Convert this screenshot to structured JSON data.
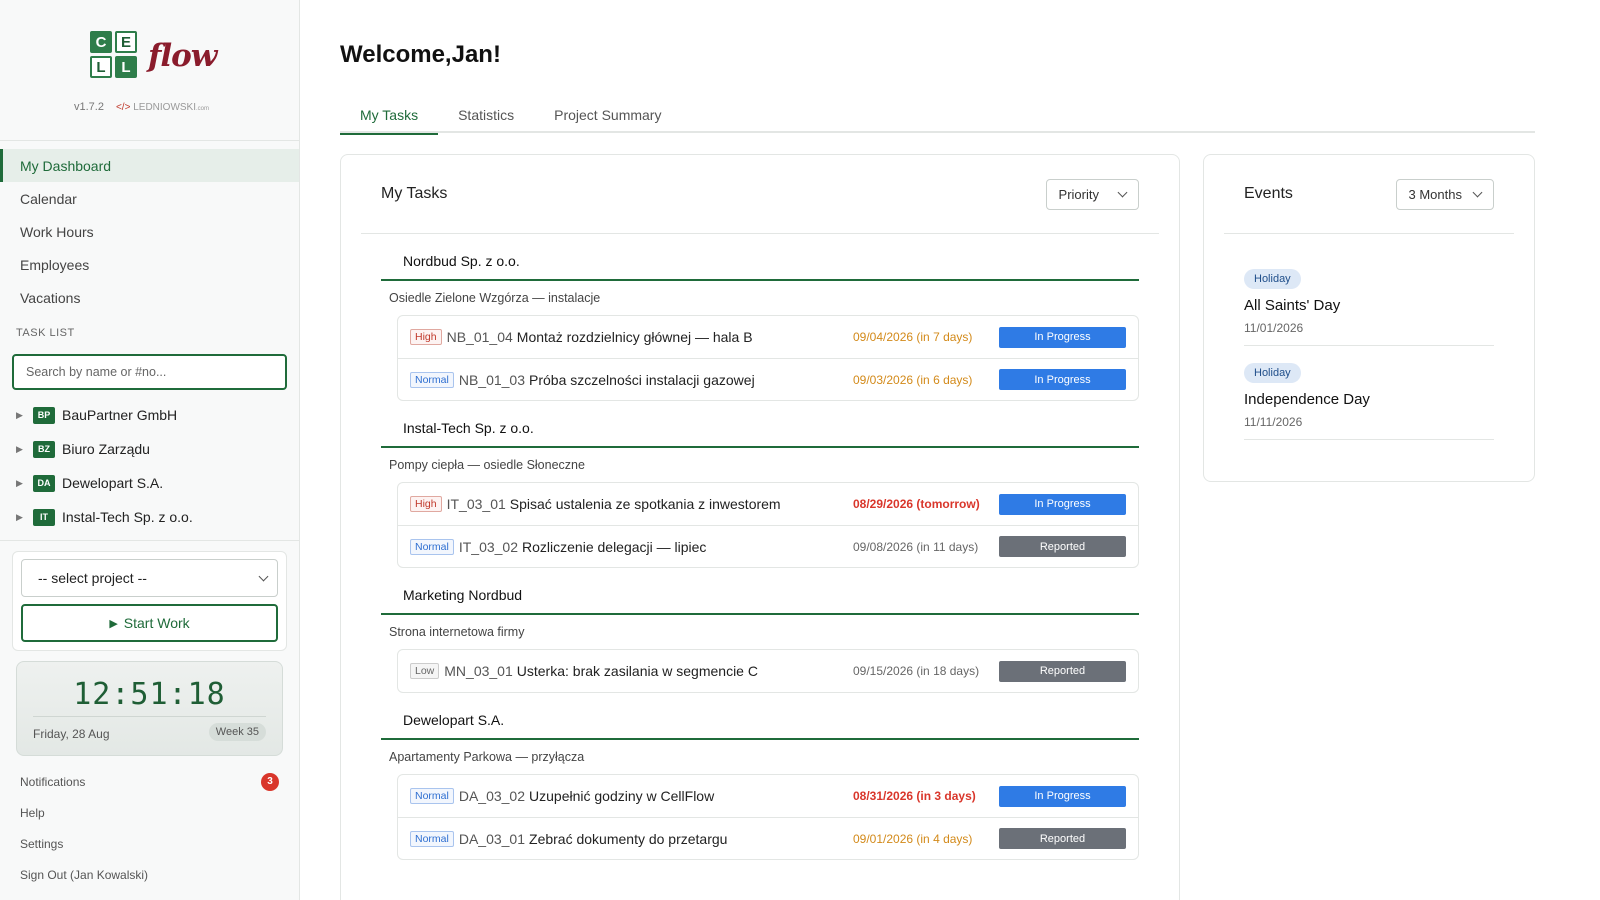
{
  "app": {
    "logo_letters": [
      "C",
      "E",
      "L",
      "L"
    ],
    "logo_word": "flow",
    "version": "v1.7.2",
    "brand_code": "</>",
    "brand_name": "LEDNIOWSKI",
    "brand_suffix": ".com"
  },
  "sidebar": {
    "nav": [
      {
        "label": "My Dashboard",
        "active": true
      },
      {
        "label": "Calendar"
      },
      {
        "label": "Work Hours"
      },
      {
        "label": "Employees"
      },
      {
        "label": "Vacations"
      }
    ],
    "task_list_label": "TASK LIST",
    "search_placeholder": "Search by name or #no...",
    "clients": [
      {
        "badge": "BP",
        "name": "BauPartner GmbH"
      },
      {
        "badge": "BZ",
        "name": "Biuro Zarządu"
      },
      {
        "badge": "DA",
        "name": "Dewelopart S.A."
      },
      {
        "badge": "IT",
        "name": "Instal-Tech Sp. z o.o."
      }
    ],
    "project_select": "-- select project --",
    "start_work": "Start Work",
    "clock": {
      "time": "12:51:18",
      "date": "Friday, 28 Aug",
      "week": "Week 35"
    },
    "links": {
      "notifications": "Notifications",
      "notifications_count": "3",
      "help": "Help",
      "settings": "Settings",
      "sign_out": "Sign Out (Jan Kowalski)"
    }
  },
  "main": {
    "welcome": "Welcome,Jan!",
    "tabs": [
      "My Tasks",
      "Statistics",
      "Project Summary"
    ],
    "tasks_title": "My Tasks",
    "sort_label": "Priority",
    "groups": [
      {
        "client": "Nordbud Sp. z o.o.",
        "project": "Osiedle Zielone Wzgórza — instalacje",
        "tasks": [
          {
            "priority": "High",
            "code": "NB_01_04",
            "name": "Montaż rozdzielnicy głównej — hala B",
            "date": "09/04/2026 (in 7 days)",
            "status": "In Progress"
          },
          {
            "priority": "Normal",
            "code": "NB_01_03",
            "name": "Próba szczelności instalacji gazowej",
            "date": "09/03/2026 (in 6 days)",
            "status": "In Progress"
          }
        ]
      },
      {
        "client": "Instal-Tech Sp. z o.o.",
        "project": "Pompy ciepła — osiedle Słoneczne",
        "tasks": [
          {
            "priority": "High",
            "code": "IT_03_01",
            "name": "Spisać ustalenia ze spotkania z inwestorem",
            "date": "08/29/2026 (tomorrow)",
            "status": "In Progress"
          },
          {
            "priority": "Normal",
            "code": "IT_03_02",
            "name": "Rozliczenie delegacji — lipiec",
            "date": "09/08/2026 (in 11 days)",
            "status": "Reported"
          }
        ]
      },
      {
        "client": "Marketing Nordbud",
        "project": "Strona internetowa firmy",
        "tasks": [
          {
            "priority": "Low",
            "code": "MN_03_01",
            "name": "Usterka: brak zasilania w segmencie C",
            "date": "09/15/2026 (in 18 days)",
            "status": "Reported"
          }
        ]
      },
      {
        "client": "Dewelopart S.A.",
        "project": "Apartamenty Parkowa — przyłącza",
        "tasks": [
          {
            "priority": "Normal",
            "code": "DA_03_02",
            "name": "Uzupełnić godziny w CellFlow",
            "date": "08/31/2026 (in 3 days)",
            "status": "In Progress"
          },
          {
            "priority": "Normal",
            "code": "DA_03_01",
            "name": "Zebrać dokumenty do przetargu",
            "date": "09/01/2026 (in 4 days)",
            "status": "Reported"
          }
        ]
      }
    ],
    "events_title": "Events",
    "events_range": "3 Months",
    "events": [
      {
        "badge": "Holiday",
        "title": "All Saints' Day",
        "date": "11/01/2026"
      },
      {
        "badge": "Holiday",
        "title": "Independence Day",
        "date": "11/11/2026"
      }
    ]
  },
  "colors": {
    "brand_green": "#1f6b3a",
    "logo_red": "#8a1c2c",
    "in_progress": "#2f7be5",
    "reported": "#6b7078",
    "urgent": "#d9362b",
    "soon": "#d38a1a"
  }
}
